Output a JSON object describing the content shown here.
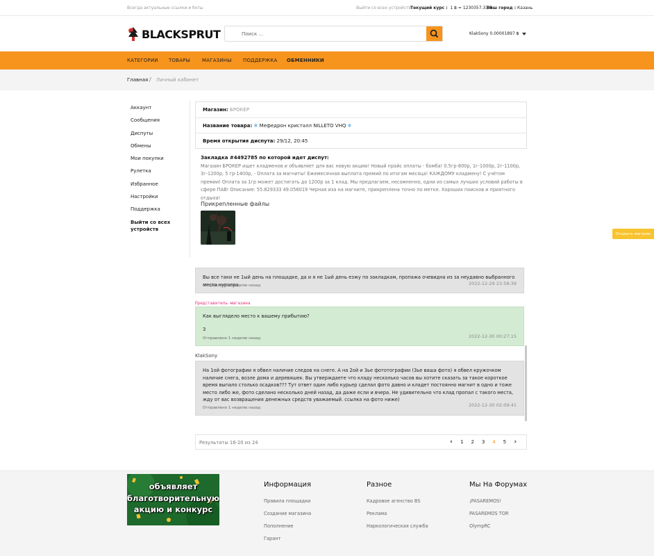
{
  "topbar": {
    "tagline": "Всегда актуальные ссылки и боты",
    "logout_all": "Выйти со всех устройств",
    "rate_label": "Текущий курс :",
    "rate_value": "1 ฿ = 1230357.33 ₽",
    "city_label": "Ваш город :",
    "city_value": "Казань"
  },
  "header": {
    "logo_text": "BLACKSPRUT",
    "search_placeholder": "Поиск ...",
    "user_balance": "KlakSony 0.00001897 ฿"
  },
  "nav": {
    "items": [
      "КАТЕГОРИИ",
      "ТОВАРЫ",
      "МАГАЗИНЫ",
      "ПОДДЕРЖКА",
      "ОБМЕННИКИ"
    ]
  },
  "breadcrumb": {
    "home": "Главная",
    "separator": "/",
    "current": "Личный кабинет"
  },
  "sidebar": {
    "items": [
      "Аккаунт",
      "Сообщения",
      "Диспуты",
      "Обмены",
      "Мои покупки",
      "Рулетка",
      "Избранное",
      "Настройки",
      "Поддержка"
    ],
    "logout": "Выйти со всех устройств"
  },
  "dispute_info": {
    "shop_label": "Магазин:",
    "shop_value": "БРОКЕР",
    "product_label": "Название товара:",
    "product_value": "Мефедрон кристалл NILLETO VHQ",
    "opened_label": "Время открытия диспута:",
    "opened_value": "29/12, 20:45"
  },
  "dispute": {
    "heading": "Закладка #4492785 по которой идет диспут:",
    "description": "Магазин БРОКЕР ищет кладменов и объявляет для вас новую акцию! Новый прайс оплаты - бомба! 0.5гр-800р, 1г-1000р, 2г-1100р, 3г-1200р, 5 гр-1400р, - Оплата за магниты! Ежемесячная выплата премий по итогам месяца! КАЖДОМУ кладмену! С учётом премии! Оплата за 1гр может достигать до 1200р за 1 клад. Мы предлагаем, несомненно, одни из самых лучших условий работы в сфере ПАВ! Описание: 55.829333 49.056019 Черная иза на магните, прикреплена точно по метке. Хороших поисков и приятного отдыха!",
    "files_title": "Прикрепленные файлы"
  },
  "messages": [
    {
      "text": "Вы все таки не 1ый день на площадке, да и я не 1ый день езжу по закладкам, пропажа очевидна из за неудавно выбранного места курьера",
      "date": "2022-12-29 23:58:39",
      "sent": "Отправлено 1 неделю назад"
    },
    {
      "role": "Представитель магазина",
      "line1": "Как выглядело место к вашему прибытию?",
      "line2": "3",
      "date": "2022-12-30 00:27:15",
      "sent": "Отправлено 1 неделю назад"
    },
    {
      "author": "KlakSony",
      "text": "На 1ой фотографии я обвел наличие следов на снеге. А на 2ой и 3ье фототографии (3ье ваша фото) я обвел кружочком наличие снега, возле дома и деревяшек. Вы утверждаете что кладу несколько часов вы хотите сказать за такое короткое время выпало столько осадков??? Тут ответ один либо курьер сделал фото давно и кладет постоянно магнит в одно и тоже место либо же, фото сделано несколько дней назад, да даже если и вчера. Не удивительно что клад пропал с такого места, жду от вас возвращения денежных средств уважаемый. ссылка на фото нижe)",
      "date": "2022-12-30 02:09:41",
      "sent": "Отправлено 1 неделю назад"
    }
  ],
  "pagination": {
    "results": "Результаты 16-20 из 24",
    "pages": [
      "1",
      "2",
      "3",
      "4",
      "5"
    ],
    "active": "4"
  },
  "open_shop": "Открыть магазин",
  "footer": {
    "banner_lines": [
      "объявляет",
      "благотворительную",
      "акцию и конкурс"
    ],
    "columns": [
      {
        "title": "Информация",
        "links": [
          "Правила площадки",
          "Создание магазина",
          "Пополнение",
          "Гарант"
        ]
      },
      {
        "title": "Разное",
        "links": [
          "Кадровое агенство BS",
          "Реклама",
          "Наркологическая служба"
        ]
      },
      {
        "title": "Мы На Форумах",
        "links": [
          "¡PASAREMOS!",
          "PASAREMOS TOR",
          "OlympRC"
        ]
      }
    ]
  },
  "colors": {
    "accent": "#f7941d",
    "shop_button": "#f7c32e",
    "role_label": "#e5337a",
    "message_grey": "#e3e3e3",
    "message_green": "#d3ebd3"
  }
}
